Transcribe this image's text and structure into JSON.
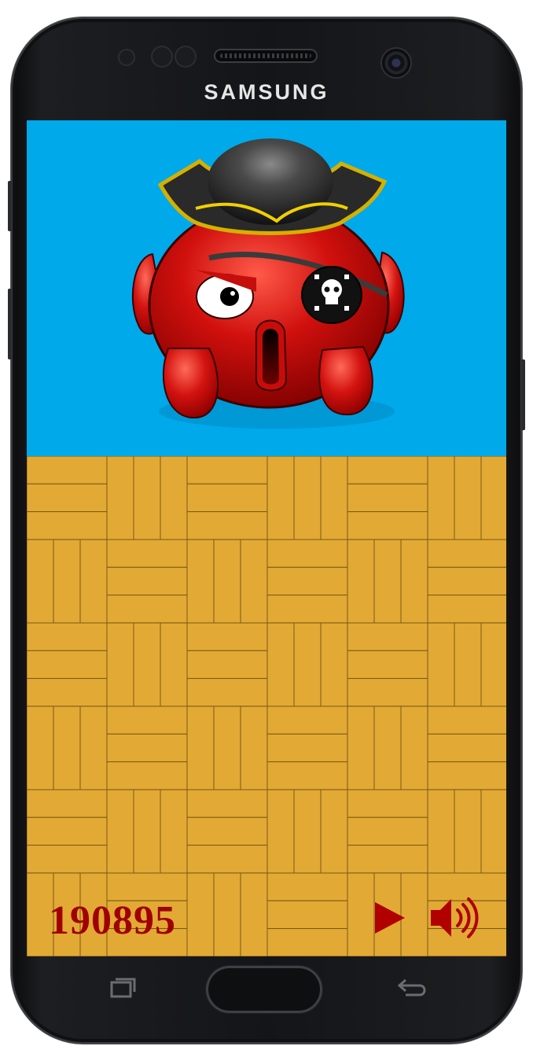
{
  "device": {
    "brand": "SAMSUNG",
    "body_color": "#151619"
  },
  "game": {
    "score": "190895",
    "character": "pirate-octopus",
    "sky_color": "#00A9EA",
    "floor_color": "#E2A935",
    "score_color": "#A00000"
  },
  "controls": {
    "play_icon": "play-icon",
    "sound_icon": "speaker-volume-icon"
  },
  "system_nav": {
    "recents_icon": "recent-apps-icon",
    "home_icon": "home-button",
    "back_icon": "back-arrow-icon"
  }
}
